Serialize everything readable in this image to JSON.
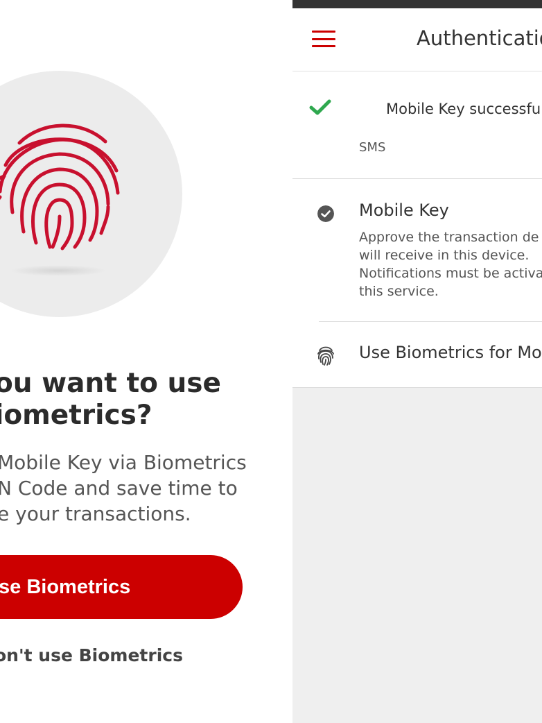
{
  "left_screen": {
    "title_lines": [
      "ou want to use",
      "iometrics?"
    ],
    "description_lines": [
      "Mobile Key via Biometrics",
      "N Code and save time to",
      "e your transactions."
    ],
    "primary_button": "se Biometrics",
    "secondary_link": "on't use Biometrics",
    "icons": {
      "illustration": "fingerprint-icon"
    },
    "colors": {
      "accent": "#cc0000",
      "circle": "#ececec"
    }
  },
  "right_screen": {
    "header": {
      "title": "Authenticatio",
      "menu_icon": "hamburger-icon"
    },
    "toast": {
      "text": "Mobile Key successfully",
      "icon": "check-icon",
      "color": "#2fa84f"
    },
    "list": {
      "sms_label": "SMS",
      "mobile_key": {
        "title": "Mobile Key",
        "desc_lines": [
          "Approve the transaction de",
          "will receive in this device.",
          "Notifications must be activa",
          "this service."
        ],
        "icon": "check-circle-icon"
      },
      "biometrics": {
        "label": "Use Biometrics for Mob",
        "icon": "fingerprint-icon"
      }
    }
  }
}
